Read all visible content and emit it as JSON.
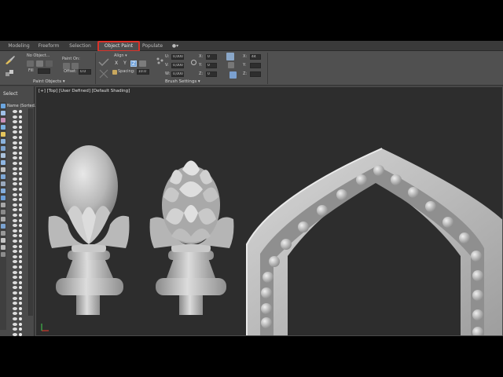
{
  "ribbon": {
    "tabs": [
      "Modeling",
      "Freeform",
      "Selection",
      "Object Paint",
      "Populate",
      "●▾"
    ],
    "active_tab": "Object Paint",
    "paint_objects": {
      "object_label": "No Object...",
      "paint_on_label": "Paint On:",
      "fill_label": "Fill",
      "offset_label": "Offset:",
      "offset_value": "0.0",
      "group_title": "Paint Objects ▾"
    },
    "brush": {
      "align_label": "Align ▾",
      "x_label": "X",
      "y_label": "Y",
      "z_label": "Z",
      "spacing_label": "Spacing:",
      "spacing_value": "10.0",
      "u_label": "U:",
      "v_label": "V:",
      "w_label": "W:",
      "u_value": "0,000",
      "v_value": "0,000",
      "w_value": "0,000",
      "rx_label": "X:",
      "ry_label": "Y:",
      "rz_label": "Z:",
      "rx_value": "0",
      "ry_value": "0",
      "rz_value": "0",
      "sx_label": "X:",
      "sy_label": "Y:",
      "sz_label": "Z:",
      "sx_value": "44",
      "sy_value": "",
      "sz_value": "",
      "group_title": "Brush Settings ▾"
    }
  },
  "explorer": {
    "title": "Select",
    "list_header": "Name (Sorted..."
  },
  "viewport": {
    "label": "[+] [Top] [User Defined] [Default Shading]"
  },
  "colors": {
    "viewport_bg": "#2d2d2d",
    "ui_bg": "#444444",
    "active_tab_border": "#d9322a",
    "axis_x": "#d0392b",
    "axis_y": "#3fb64a"
  }
}
